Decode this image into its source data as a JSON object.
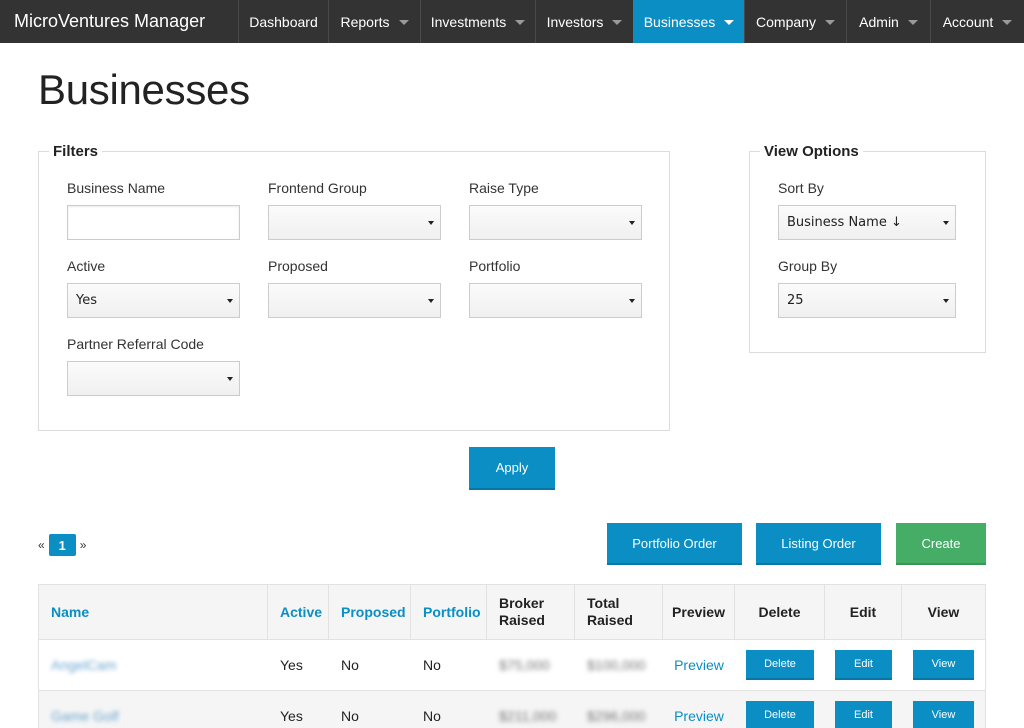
{
  "app": {
    "brand": "MicroVentures Manager"
  },
  "nav": [
    {
      "label": "Dashboard",
      "dropdown": false,
      "active": false
    },
    {
      "label": "Reports",
      "dropdown": true,
      "active": false
    },
    {
      "label": "Investments",
      "dropdown": true,
      "active": false
    },
    {
      "label": "Investors",
      "dropdown": true,
      "active": false
    },
    {
      "label": "Businesses",
      "dropdown": true,
      "active": true
    },
    {
      "label": "Company",
      "dropdown": true,
      "active": false
    },
    {
      "label": "Admin",
      "dropdown": true,
      "active": false
    },
    {
      "label": "Account",
      "dropdown": true,
      "active": false
    }
  ],
  "page": {
    "title": "Businesses"
  },
  "filters": {
    "legend": "Filters",
    "business_name": {
      "label": "Business Name",
      "value": ""
    },
    "frontend_group": {
      "label": "Frontend Group",
      "value": ""
    },
    "raise_type": {
      "label": "Raise Type",
      "value": ""
    },
    "active": {
      "label": "Active",
      "value": "Yes"
    },
    "proposed": {
      "label": "Proposed",
      "value": ""
    },
    "portfolio": {
      "label": "Portfolio",
      "value": ""
    },
    "partner_referral_code": {
      "label": "Partner Referral Code",
      "value": ""
    }
  },
  "view_options": {
    "legend": "View Options",
    "sort_by": {
      "label": "Sort By",
      "value": "Business Name ↓"
    },
    "group_by": {
      "label": "Group By",
      "value": "25"
    }
  },
  "actions": {
    "apply": "Apply",
    "portfolio_order": "Portfolio Order",
    "listing_order": "Listing Order",
    "create": "Create"
  },
  "pagination": {
    "prev": "«",
    "current": "1",
    "next": "»"
  },
  "table": {
    "headers": {
      "name": "Name",
      "active": "Active",
      "proposed": "Proposed",
      "portfolio": "Portfolio",
      "broker_raised": "Broker Raised",
      "total_raised": "Total Raised",
      "preview": "Preview",
      "delete": "Delete",
      "edit": "Edit",
      "view": "View"
    },
    "rows": [
      {
        "name": "AngelCam",
        "active": "Yes",
        "proposed": "No",
        "portfolio": "No",
        "broker_raised": "$75,000",
        "total_raised": "$100,000",
        "preview": "Preview",
        "delete": "Delete",
        "edit": "Edit",
        "view": "View"
      },
      {
        "name": "Game Golf",
        "active": "Yes",
        "proposed": "No",
        "portfolio": "No",
        "broker_raised": "$211,000",
        "total_raised": "$296,000",
        "preview": "Preview",
        "delete": "Delete",
        "edit": "Edit",
        "view": "View"
      }
    ]
  },
  "colors": {
    "topbar": "#333333",
    "accent": "#0a8ec3",
    "create": "#46ad66"
  }
}
